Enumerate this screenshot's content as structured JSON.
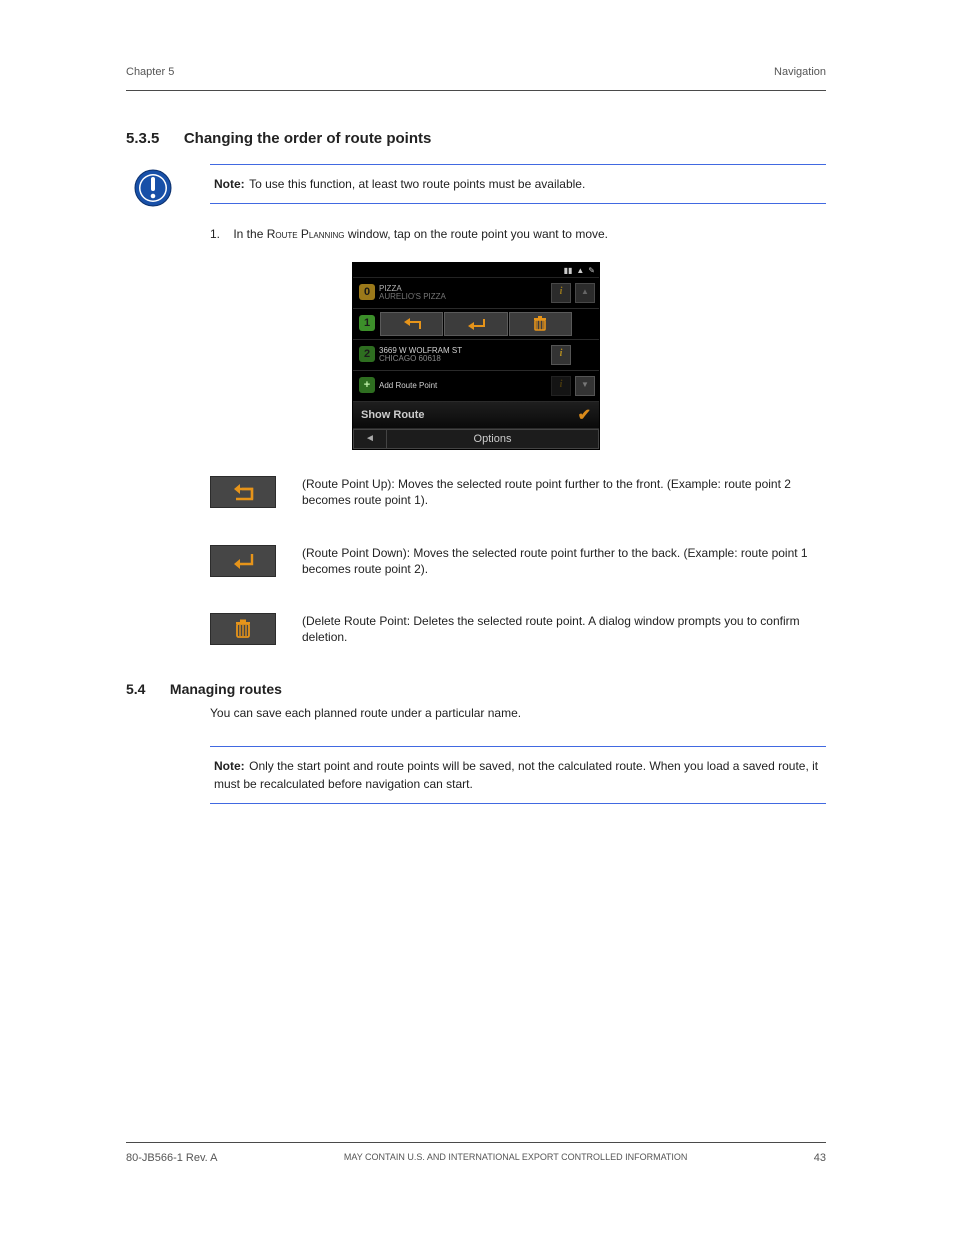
{
  "header": {
    "left": "Chapter 5",
    "right": "Navigation"
  },
  "footer": {
    "left": "80-JB566-1 Rev. A",
    "center": "MAY CONTAIN U.S. AND INTERNATIONAL EXPORT CONTROLLED INFORMATION",
    "right": "43"
  },
  "section": {
    "number": "5.3.5",
    "title": "Changing the order of route points"
  },
  "note": {
    "label": "Note:",
    "text": "To use this function, at least two route points must be available."
  },
  "steps": {
    "one_label": "1.",
    "one_text": "In the Route Planning window, tap on the route point you want to move.",
    "one_suffix_screen": "Route Planning"
  },
  "figure": {
    "alt": "Route Planning window with action strip",
    "status_icons": [
      "battery",
      "warning",
      "tool"
    ],
    "rows": {
      "r0": {
        "num": "0",
        "line1": "PIZZA",
        "line2": "AURELIO'S PIZZA"
      },
      "r1": {
        "num": "1"
      },
      "r2": {
        "num": "2",
        "line1": "3669 W WOLFRAM ST",
        "line2": "CHICAGO 60618"
      },
      "add": {
        "num": "+",
        "line1": "Add Route Point"
      }
    },
    "showroute_label": "Show Route",
    "bottom_back": "◄",
    "bottom_options": "Options"
  },
  "legend": {
    "up": {
      "label": "Route Point Up",
      "desc": "(Route Point Up): Moves the selected route point further to the front. (Example: route point 2 becomes route point 1)."
    },
    "down": {
      "label": "Route Point Down",
      "desc": "(Route Point Down): Moves the selected route point further to the back. (Example: route point 1 becomes route point 2)."
    },
    "del": {
      "label": "Delete Route Point:",
      "desc": "(Delete Route Point: Deletes the selected route point. A dialog window prompts you to confirm deletion."
    }
  },
  "manage": {
    "number": "5.4",
    "title": "Managing routes",
    "body": "You can save each planned route under a particular name.",
    "note_label": "Note:",
    "note_text": "Only the start point and route points will be saved, not the calculated route. When you load a saved route, it must be recalculated before navigation can start."
  }
}
